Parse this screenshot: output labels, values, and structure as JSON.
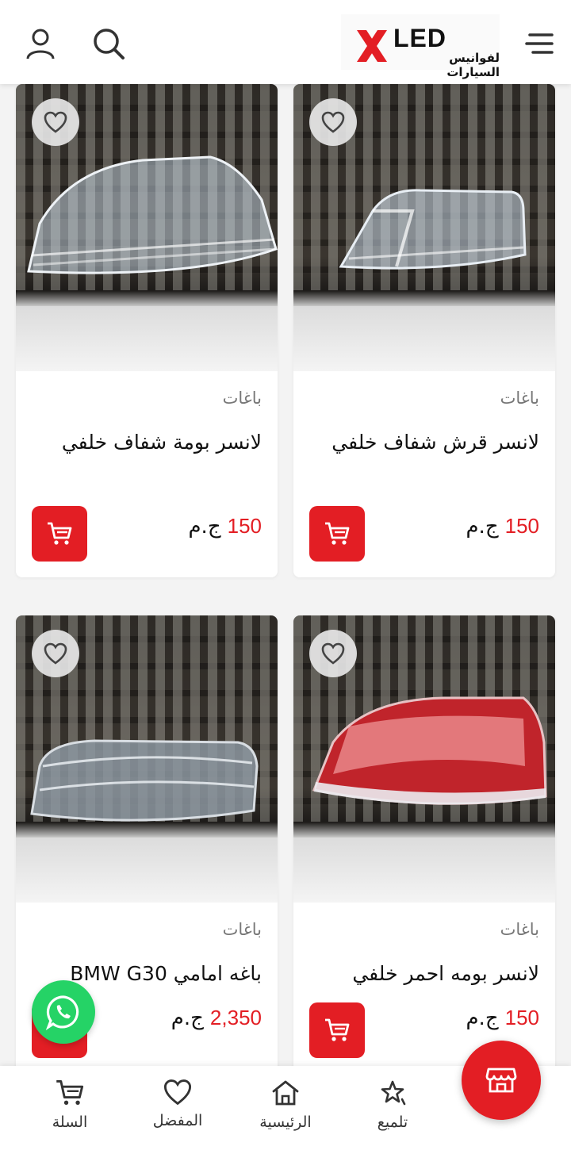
{
  "header": {
    "logo_text": "LED",
    "logo_subtitle": "لفوانيس السيارات",
    "colors": {
      "brand_red": "#e31e24"
    }
  },
  "products": [
    {
      "brand": "باغات",
      "title": "لانسر قرش شفاف خلفي",
      "price": "150",
      "currency": "ج.م"
    },
    {
      "brand": "باغات",
      "title": "لانسر بومة شفاف خلفي",
      "price": "150",
      "currency": "ج.م"
    },
    {
      "brand": "باغات",
      "title": "لانسر بومه احمر خلفي",
      "price": "150",
      "currency": "ج.م"
    },
    {
      "brand": "باغات",
      "title": "باغه امامي BMW G30",
      "price": "2,350",
      "currency": "ج.م"
    }
  ],
  "bottom_nav": {
    "items": [
      {
        "label": "تلميع",
        "icon": "sparkle-star-icon"
      },
      {
        "label": "الرئيسية",
        "icon": "home-icon"
      },
      {
        "label": "المفضل",
        "icon": "heart-icon"
      },
      {
        "label": "السلة",
        "icon": "cart-icon"
      }
    ]
  }
}
